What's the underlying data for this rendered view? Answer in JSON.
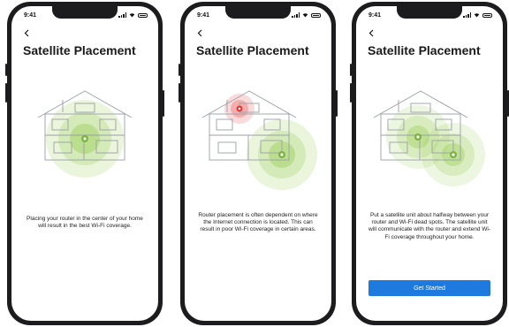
{
  "colors": {
    "accent": "#1f7ae0",
    "coverage": "#8cc63f",
    "poor": "#e53935"
  },
  "screens": [
    {
      "time": "9:41",
      "back_icon": "chevron-left-icon",
      "title": "Satellite Placement",
      "body": "Placing your router in the center of your home will result in the best Wi-Fi coverage."
    },
    {
      "time": "9:41",
      "back_icon": "chevron-left-icon",
      "title": "Satellite Placement",
      "body": "Router placement is often dependent on where the Internet connection is located. This can result in poor Wi-Fi coverage in certain areas."
    },
    {
      "time": "9:41",
      "back_icon": "chevron-left-icon",
      "title": "Satellite Placement",
      "body": "Put a satellite unit about halfway between your router and Wi-Fi dead spots. The satellite unit will communicate with the router and extend Wi-Fi coverage throughout your home.",
      "cta_label": "Get Started"
    }
  ]
}
